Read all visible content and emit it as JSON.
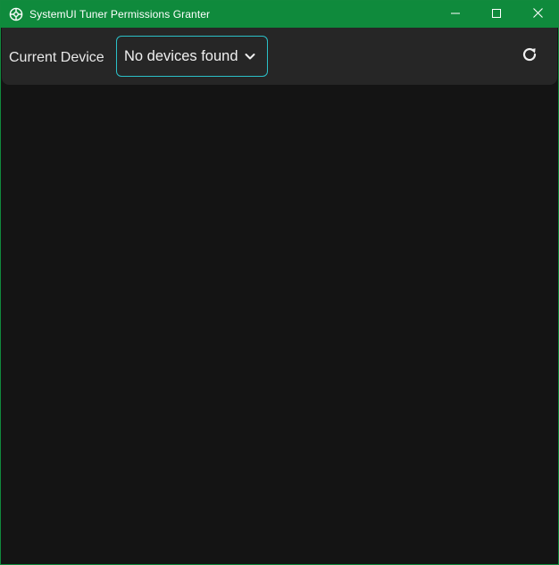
{
  "window": {
    "title": "SystemUI Tuner Permissions Granter",
    "app_icon": "settings-gear-icon",
    "controls": [
      "minimize-icon",
      "maximize-icon",
      "close-icon"
    ],
    "colors": {
      "titlebar": "#0f8a3c",
      "background": "#141414",
      "toolbar": "#262626",
      "accent": "#2bc0c8"
    }
  },
  "toolbar": {
    "device_label": "Current Device",
    "device_select": {
      "value": "No devices found",
      "icon": "chevron-down-icon"
    },
    "refresh_icon": "refresh-icon"
  }
}
